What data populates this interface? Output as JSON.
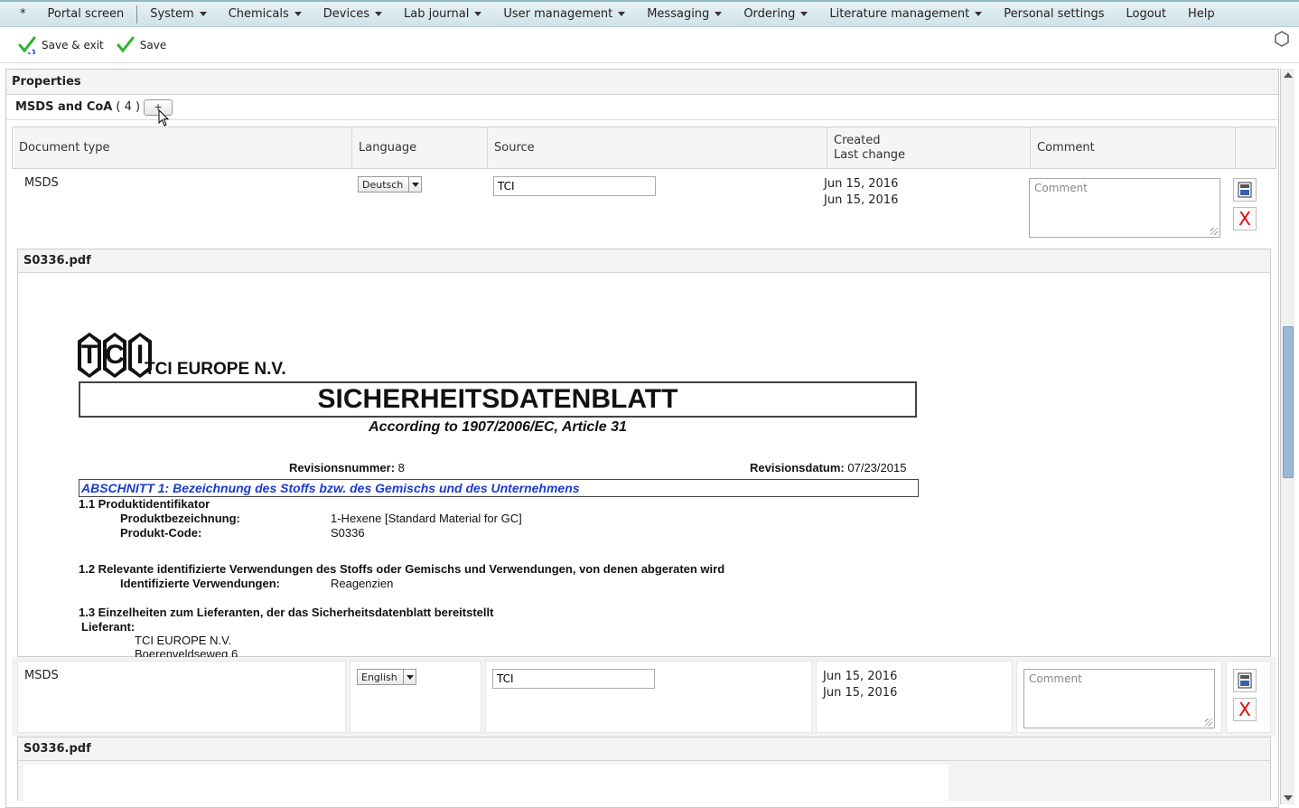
{
  "menu": {
    "star": "*",
    "items": [
      {
        "label": "Portal screen",
        "caret": false
      },
      {
        "label": "System",
        "caret": true
      },
      {
        "label": "Chemicals",
        "caret": true
      },
      {
        "label": "Devices",
        "caret": true
      },
      {
        "label": "Lab journal",
        "caret": true
      },
      {
        "label": "User management",
        "caret": true
      },
      {
        "label": "Messaging",
        "caret": true
      },
      {
        "label": "Ordering",
        "caret": true
      },
      {
        "label": "Literature management",
        "caret": true
      },
      {
        "label": "Personal settings",
        "caret": false
      },
      {
        "label": "Logout",
        "caret": false
      },
      {
        "label": "Help",
        "caret": false
      }
    ]
  },
  "toolbar": {
    "save_exit": "Save & exit",
    "save": "Save"
  },
  "properties": {
    "title": "Properties"
  },
  "msds": {
    "title": "MSDS and CoA",
    "count": "( 4 )",
    "add": "+"
  },
  "table": {
    "headers": {
      "doc_type": "Document type",
      "language": "Language",
      "source": "Source",
      "created": "Created",
      "last_change": "Last change",
      "comment": "Comment"
    },
    "rows": [
      {
        "doc_type": "MSDS",
        "language": "Deutsch",
        "source": "TCI",
        "created": "Jun 15, 2016",
        "changed": "Jun 15, 2016",
        "comment_placeholder": "Comment",
        "file": "S0336.pdf"
      },
      {
        "doc_type": "MSDS",
        "language": "English",
        "source": "TCI",
        "created": "Jun 15, 2016",
        "changed": "Jun 15, 2016",
        "comment_placeholder": "Comment",
        "file": "S0336.pdf"
      }
    ],
    "delete_label": "X"
  },
  "pdf": {
    "logo_letters": [
      "T",
      "C",
      "I"
    ],
    "company": "TCI EUROPE N.V.",
    "title": "SICHERHEITSDATENBLATT",
    "subtitle": "According to 1907/2006/EC, Article 31",
    "rev_num_label": "Revisionsnummer:",
    "rev_num": "8",
    "rev_date_label": "Revisionsdatum:",
    "rev_date": "07/23/2015",
    "section1": "ABSCHNITT 1: Bezeichnung des Stoffs bzw. des Gemischs und des Unternehmens",
    "s11": "1.1 Produktidentifikator",
    "prod_name_label": "Produktbezeichnung:",
    "prod_name": "1-Hexene [Standard Material for GC]",
    "prod_code_label": "Produkt-Code:",
    "prod_code": "S0336",
    "s12": "1.2 Relevante identifizierte Verwendungen des Stoffs oder Gemischs und Verwendungen, von denen abgeraten wird",
    "use_label": "Identifizierte Verwendungen:",
    "use": "Reagenzien",
    "s13": "1.3 Einzelheiten zum Lieferanten, der das Sicherheitsdatenblatt bereitstellt",
    "supplier_label": "Lieferant:",
    "supplier": "TCI EUROPE N.V.",
    "address_partial": "Boerenveldseweg 6"
  }
}
